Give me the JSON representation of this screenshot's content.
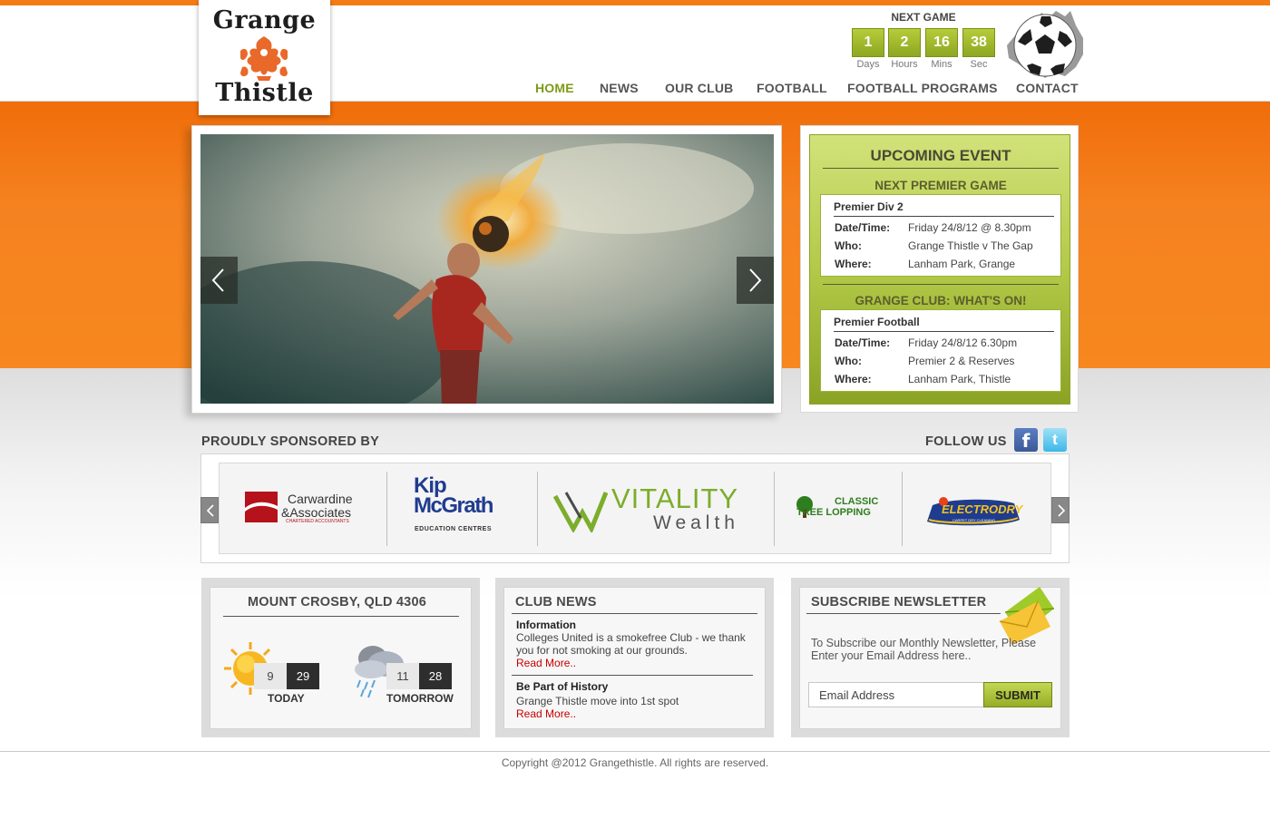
{
  "logo": {
    "line1": "Grange",
    "line2": "Thistle"
  },
  "countdown": {
    "title": "NEXT GAME",
    "units": [
      {
        "value": "1",
        "label": "Days"
      },
      {
        "value": "2",
        "label": "Hours"
      },
      {
        "value": "16",
        "label": "Mins"
      },
      {
        "value": "38",
        "label": "Sec"
      }
    ]
  },
  "nav": {
    "items": [
      {
        "label": "HOME",
        "active": true
      },
      {
        "label": "NEWS"
      },
      {
        "label": "OUR CLUB"
      },
      {
        "label": "FOOTBALL"
      },
      {
        "label": "FOOTBALL PROGRAMS"
      },
      {
        "label": "CONTACT"
      }
    ]
  },
  "event": {
    "title": "UPCOMING EVENT",
    "premier": {
      "heading": "NEXT PREMIER GAME",
      "card_title": "Premier Div 2",
      "rows": [
        {
          "key": "Date/Time:",
          "value": "Friday 24/8/12 @ 8.30pm"
        },
        {
          "key": "Who:",
          "value": "Grange Thistle v The Gap"
        },
        {
          "key": "Where:",
          "value": "Lanham Park, Grange"
        }
      ]
    },
    "club": {
      "heading": "GRANGE CLUB: WHAT'S ON!",
      "card_title": "Premier Football",
      "rows": [
        {
          "key": "Date/Time:",
          "value": "Friday 24/8/12 6.30pm"
        },
        {
          "key": "Who:",
          "value": "Premier 2 & Reserves"
        },
        {
          "key": "Where:",
          "value": "Lanham Park, Thistle"
        }
      ]
    }
  },
  "sponsors": {
    "title": "PROUDLY SPONSORED BY",
    "follow": "FOLLOW US",
    "logos": [
      {
        "line1": "Carwardine",
        "line2": "&Associates",
        "line3": "CHARTERED ACCOUNTANTS"
      },
      {
        "line1": "Kip",
        "line2": "McGrath",
        "line3": "EDUCATION CENTRES"
      },
      {
        "line1": "VITALITY",
        "line2": "Wealth"
      },
      {
        "line1": "CLASSIC",
        "line2": "TREE LOPPING"
      },
      {
        "line1": "ELECTRODRY",
        "line2": "CARPET DRY CLEANING"
      }
    ],
    "colors": {
      "carwardine": "#b5121b",
      "kip": "#1f3c8f",
      "vitality": "#7cad2c"
    }
  },
  "weather": {
    "location": "MOUNT CROSBY, QLD 4306",
    "today": {
      "low": "9",
      "high": "29",
      "label": "TODAY",
      "icon": "sun-icon"
    },
    "tomorrow": {
      "low": "11",
      "high": "28",
      "label": "TOMORROW",
      "icon": "rain-cloud-icon"
    }
  },
  "news": {
    "title": "CLUB NEWS",
    "items": [
      {
        "heading": "Information",
        "body": "Colleges United is a smokefree Club - we thank you for not smoking at our grounds.",
        "link": "Read More.."
      },
      {
        "heading": "Be Part of History",
        "body": "Grange Thistle move into 1st spot",
        "link": "Read More.."
      }
    ]
  },
  "newsletter": {
    "title": "SUBSCRIBE NEWSLETTER",
    "text": "To Subscribe our Monthly Newsletter, Please Enter your Email Address here..",
    "placeholder": "Email Address",
    "submit": "SUBMIT"
  },
  "footer": {
    "copyright": "Copyright @2012 Grangethistle. All rights are reserved."
  },
  "theme": {
    "orange": "#f47c14",
    "green": "#8ea722"
  }
}
